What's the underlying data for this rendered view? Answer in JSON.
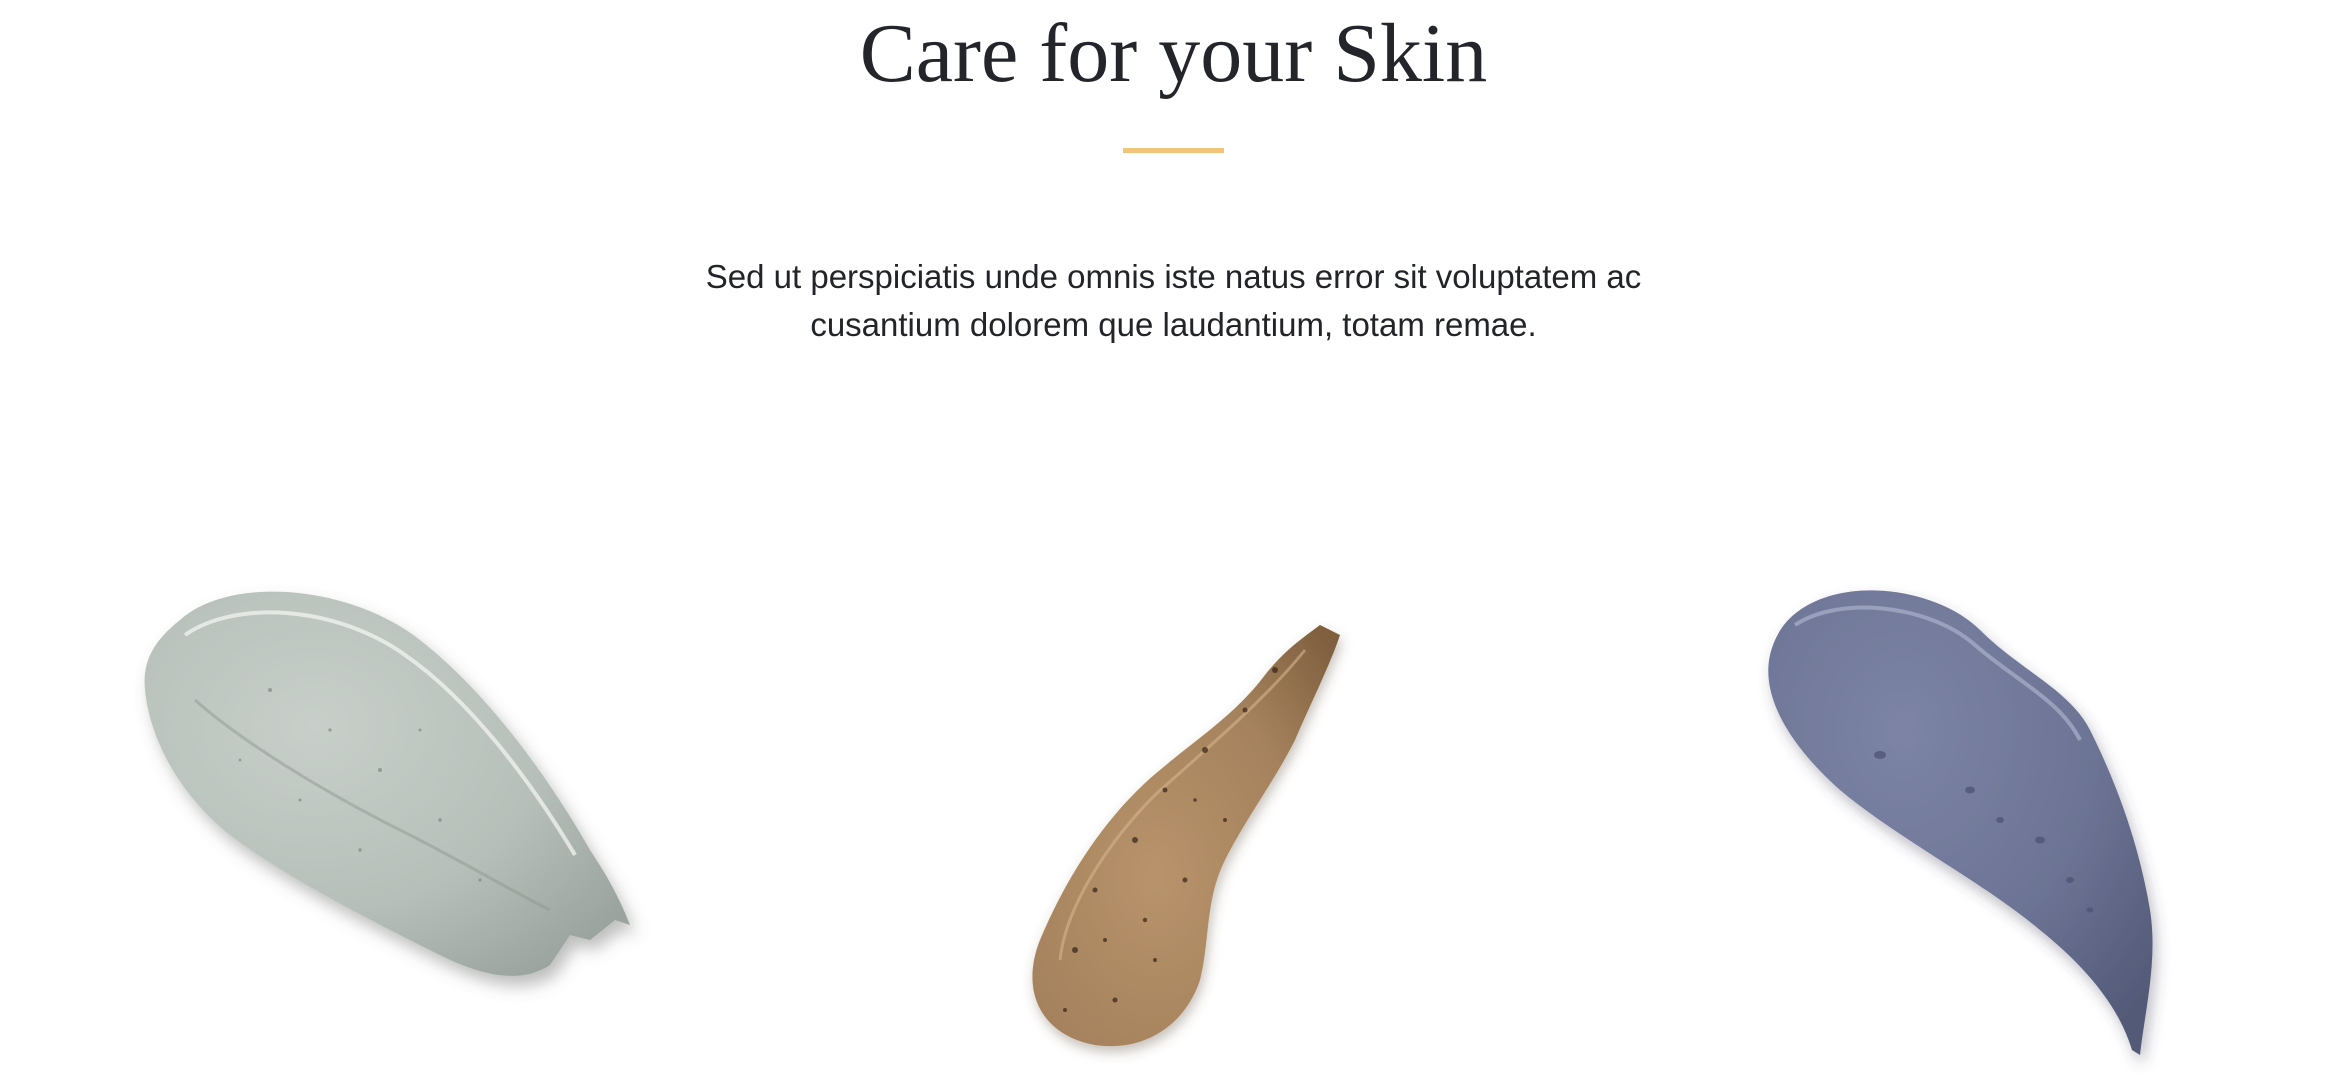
{
  "section": {
    "title": "Care for your Skin",
    "description": "Sed ut perspiciatis unde omnis iste natus error sit voluptatem ac cusantium dolorem que laudantium, totam remae."
  },
  "colors": {
    "divider": "#f1c47a",
    "clay_green": "#b9c2bc",
    "scrub_brown": "#a98661",
    "clay_blue": "#6c7394"
  },
  "products": [
    {
      "image": "green-clay-mask-swatch"
    },
    {
      "image": "coffee-scrub-swatch"
    },
    {
      "image": "blue-clay-mask-swatch"
    }
  ]
}
